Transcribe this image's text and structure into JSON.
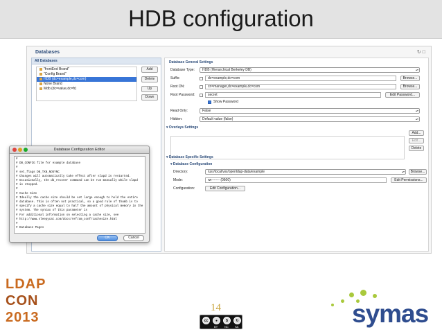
{
  "slide": {
    "title": "HDB configuration",
    "page_number": "14"
  },
  "window": {
    "title": "Databases",
    "panel_header": "All Databases",
    "databases": [
      {
        "label": "\"frontEnd Brand\"",
        "selected": false
      },
      {
        "label": "\"Config Brand\"",
        "selected": false
      },
      {
        "label": "HDB (dc=example,dc=com)",
        "selected": true
      },
      {
        "label": "None Brand",
        "selected": false
      },
      {
        "label": "Mdb (dc=value,dc=fr)",
        "selected": false
      }
    ],
    "side_buttons": [
      "Add",
      "Delete",
      "Up",
      "Down"
    ]
  },
  "general": {
    "header": "Database General Settings",
    "rows": [
      {
        "label": "Database Type:",
        "value": "HDB (Hierarchical Berkeley DB)"
      },
      {
        "label": "Suffix:",
        "value": "dc=example,dc=com",
        "button": "Browse..."
      },
      {
        "label": "Root DN:",
        "value": "cn=manager,dc=example,dc=com",
        "button": "Browse..."
      },
      {
        "label": "Root Password:",
        "value": "secret",
        "button": "Edit Password..."
      }
    ],
    "show_password": "Show Password",
    "read_only_label": "Read Only:",
    "read_only_value": "False",
    "hidden_label": "Hidden:",
    "hidden_value": "Default value (false)"
  },
  "overlays": {
    "header": "Overlays Settings",
    "buttons": [
      "Add...",
      "Edit...",
      "Delete"
    ]
  },
  "specific": {
    "header": "Database Specific Settings",
    "sub_header": "Database Configuration",
    "directory_label": "Directory:",
    "directory_value": "/usr/local/var/openldap-data/example",
    "directory_button": "Browse...",
    "mode_label": "Mode:",
    "mode_value": "rw-------  (0600)",
    "mode_button": "Edit Permissions...",
    "configuration_label": "Configuration:",
    "configuration_button": "Edit Configuration..."
  },
  "dialog": {
    "title": "Database Configuration Editor",
    "lines": [
      "#",
      "# DB_CONFIG file for example database",
      "#",
      "# set_flags DB_TXN_NOSYNC",
      "# Changes will automatically take effect after slapd is restarted.",
      "# Occasionally, the db_recover command can be run manually while slapd",
      "# is stopped.",
      "#",
      "# Cache Size",
      "# Ideally the cache size should be set large enough to hold the entire",
      "# database. This is often not practical, so a good rule of thumb is to",
      "# specify a cache size equal to half the amount of physical memory in the",
      "# system. The syntax of this parameter is",
      "# For additional information on selecting a cache size, see",
      "# http://www.sleepycat.com/docs/ref/am_conf/cachesize.html",
      "#",
      "",
      "# Database Pages"
    ],
    "ok": "OK",
    "cancel": "Cancel"
  },
  "logos": {
    "ldapcon_rows": [
      "LDAP",
      "CON",
      "2013"
    ],
    "cc_labels": [
      "BY",
      "NC",
      "SA"
    ],
    "company": "symas"
  },
  "colors": {
    "title_bar": "#e3e3e3",
    "accent": "#2a4a78",
    "selection": "#3875d7",
    "symas_blue": "#2f4d8f",
    "symas_green": "#a9c93c",
    "ldap_orange": "#c96a1f",
    "page_number": "#c9a43c"
  }
}
